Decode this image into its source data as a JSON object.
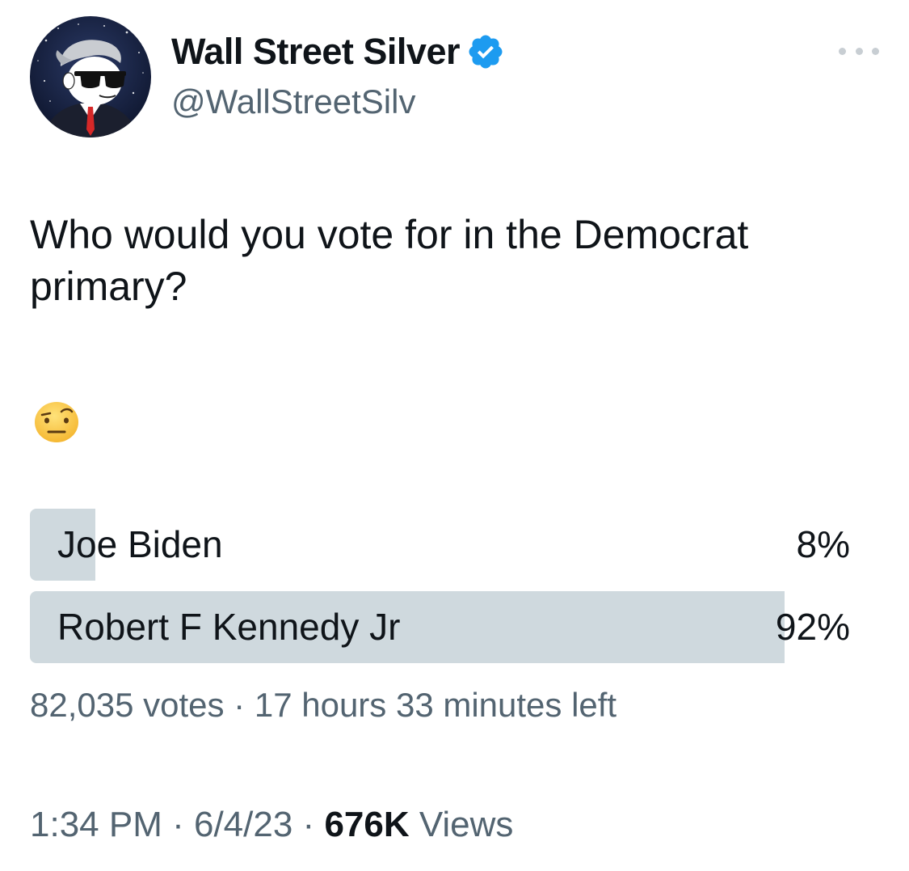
{
  "author": {
    "display_name": "Wall Street Silver",
    "handle": "@WallStreetSilv",
    "verified": true,
    "verified_badge_color": "#1d9bf0",
    "avatar_icon": "cartoon-man-sunglasses-avatar"
  },
  "tweet": {
    "text": "Who would you vote for in the Democrat primary?",
    "emoji": "🤨"
  },
  "poll": {
    "options": [
      {
        "label": "Joe Biden",
        "percent_text": "8%",
        "percent": 8
      },
      {
        "label": "Robert F Kennedy Jr",
        "percent_text": "92%",
        "percent": 92
      }
    ],
    "votes": "82,035 votes",
    "separator": " · ",
    "time_left": "17 hours 33 minutes left",
    "bar_color": "#cfd9de"
  },
  "footer": {
    "time": "1:34 PM",
    "separator": " · ",
    "date": "6/4/23",
    "views_count": "676K",
    "views_label": " Views"
  },
  "icons": {
    "more": "more-horizontal-icon",
    "verified": "verified-badge-icon"
  }
}
